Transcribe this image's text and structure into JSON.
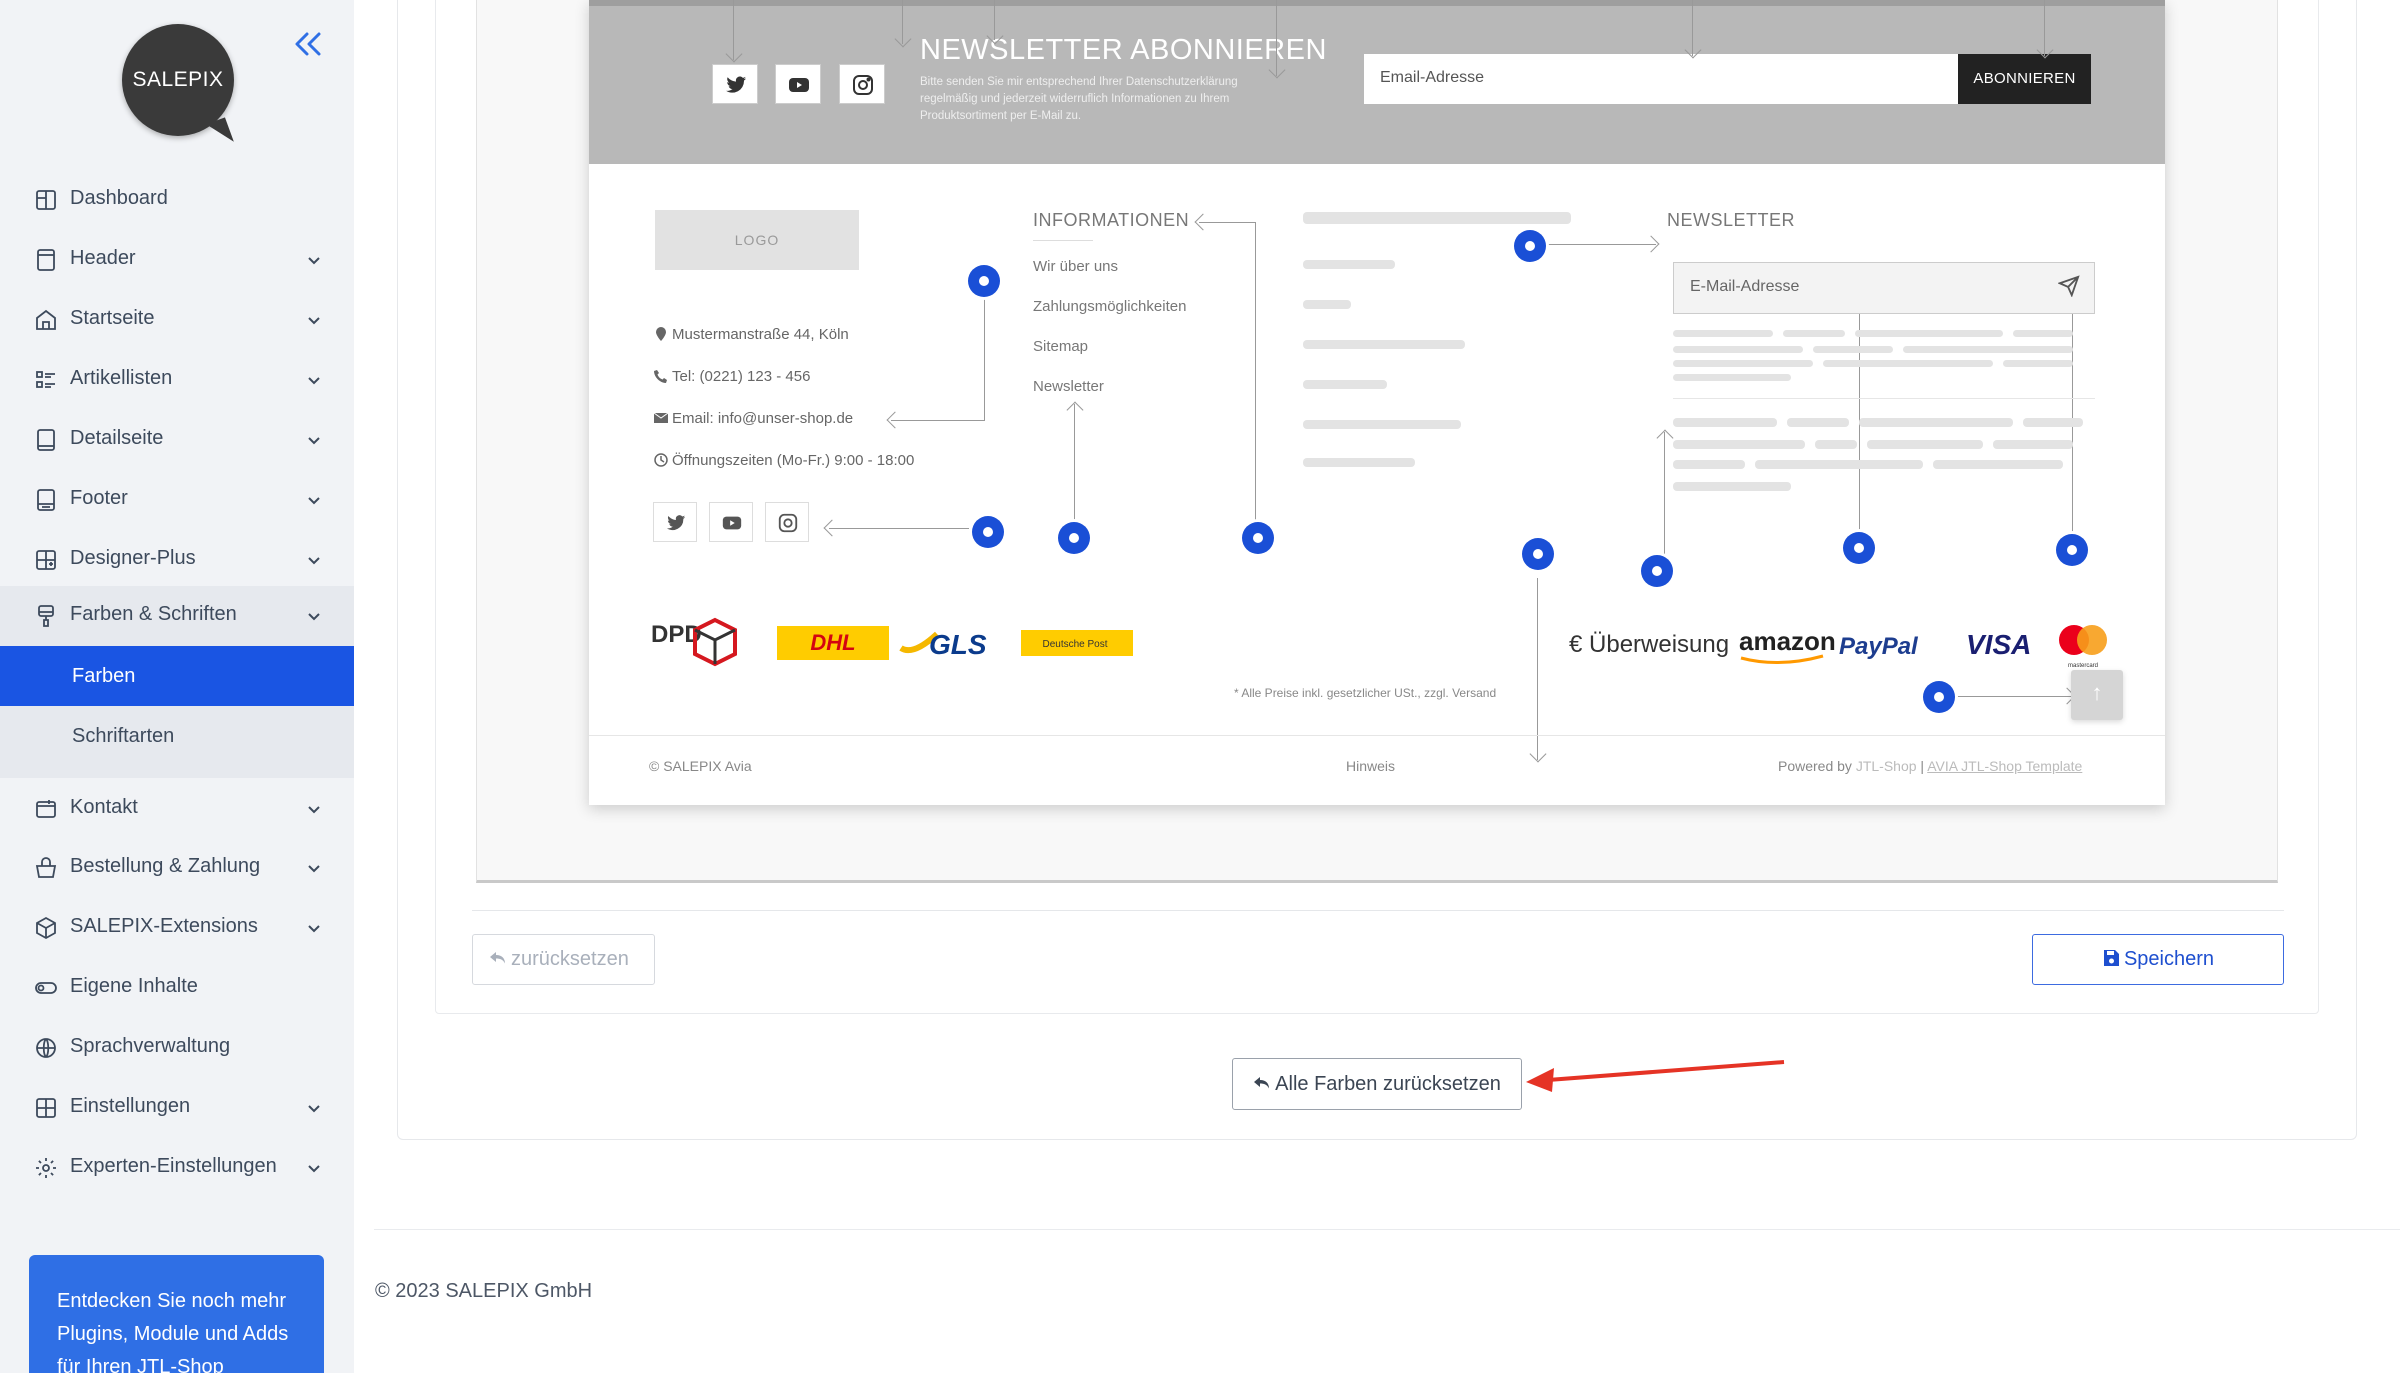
{
  "sidebar": {
    "brand": "SALEPIX",
    "items": [
      {
        "label": "Dashboard",
        "icon": "dashboard-icon"
      },
      {
        "label": "Header",
        "icon": "header-icon"
      },
      {
        "label": "Startseite",
        "icon": "home-icon"
      },
      {
        "label": "Artikellisten",
        "icon": "list-icon"
      },
      {
        "label": "Detailseite",
        "icon": "tablet-icon"
      },
      {
        "label": "Footer",
        "icon": "footer-icon"
      },
      {
        "label": "Designer-Plus",
        "icon": "grid-plus-icon"
      },
      {
        "label": "Farben & Schriften",
        "icon": "paint-icon"
      },
      {
        "label": "Kontakt",
        "icon": "contact-icon"
      },
      {
        "label": "Bestellung & Zahlung",
        "icon": "basket-icon"
      },
      {
        "label": "SALEPIX-Extensions",
        "icon": "box-icon"
      },
      {
        "label": "Eigene Inhalte",
        "icon": "toggle-icon"
      },
      {
        "label": "Sprachverwaltung",
        "icon": "globe-icon"
      },
      {
        "label": "Einstellungen",
        "icon": "settings-grid-icon"
      },
      {
        "label": "Experten-Einstellungen",
        "icon": "gear-icon"
      }
    ],
    "subitems": [
      {
        "label": "Farben",
        "active": true
      },
      {
        "label": "Schriftarten",
        "active": false
      }
    ],
    "promo": "Entdecken Sie noch mehr Plugins, Module und Adds für Ihren JTL-Shop"
  },
  "preview": {
    "newsletter_title": "NEWSLETTER ABONNIEREN",
    "newsletter_desc": "Bitte senden Sie mir entsprechend Ihrer Datenschutzerklärung regelmäßig und jederzeit widerruflich Informationen zu Ihrem Produktsortiment per E-Mail zu.",
    "email_placeholder": "Email-Adresse",
    "subscribe_label": "ABONNIEREN",
    "logo_label": "LOGO",
    "address": "Mustermanstraße 44, Köln",
    "phone": "Tel: (0221) 123 - 456",
    "email": "Email: info@unser-shop.de",
    "hours": "Öffnungszeiten (Mo-Fr.) 9:00 - 18:00",
    "info_head": "INFORMATIONEN",
    "info_links": [
      "Wir über uns",
      "Zahlungsmöglichkeiten",
      "Sitemap",
      "Newsletter"
    ],
    "newsletter_head": "NEWSLETTER",
    "newsletter_placeholder": "E-Mail-Adresse",
    "shipping": [
      "DPD",
      "DHL",
      "GLS",
      "Deutsche Post"
    ],
    "payments": [
      "€ Überweisung",
      "amazon",
      "PayPal",
      "VISA",
      "mastercard"
    ],
    "vat_note": "* Alle Preise inkl. gesetzlicher USt., zzgl. Versand",
    "footer_left": "© SALEPIX Avia",
    "footer_mid": "Hinweis",
    "footer_powered": "Powered by",
    "footer_jtl": "JTL-Shop",
    "footer_sep": "|",
    "footer_tpl": "AVIA JTL-Shop Template",
    "back_top": "↑"
  },
  "actions": {
    "reset_label": "zurücksetzen",
    "save_label": "Speichern",
    "reset_all_label": "Alle Farben zurücksetzen"
  },
  "footer": {
    "copyright": "© 2023 SALEPIX GmbH"
  },
  "colors": {
    "accent": "#1a55e3",
    "annotation_dot": "#1a4fd6",
    "arrow": "#e53325"
  }
}
